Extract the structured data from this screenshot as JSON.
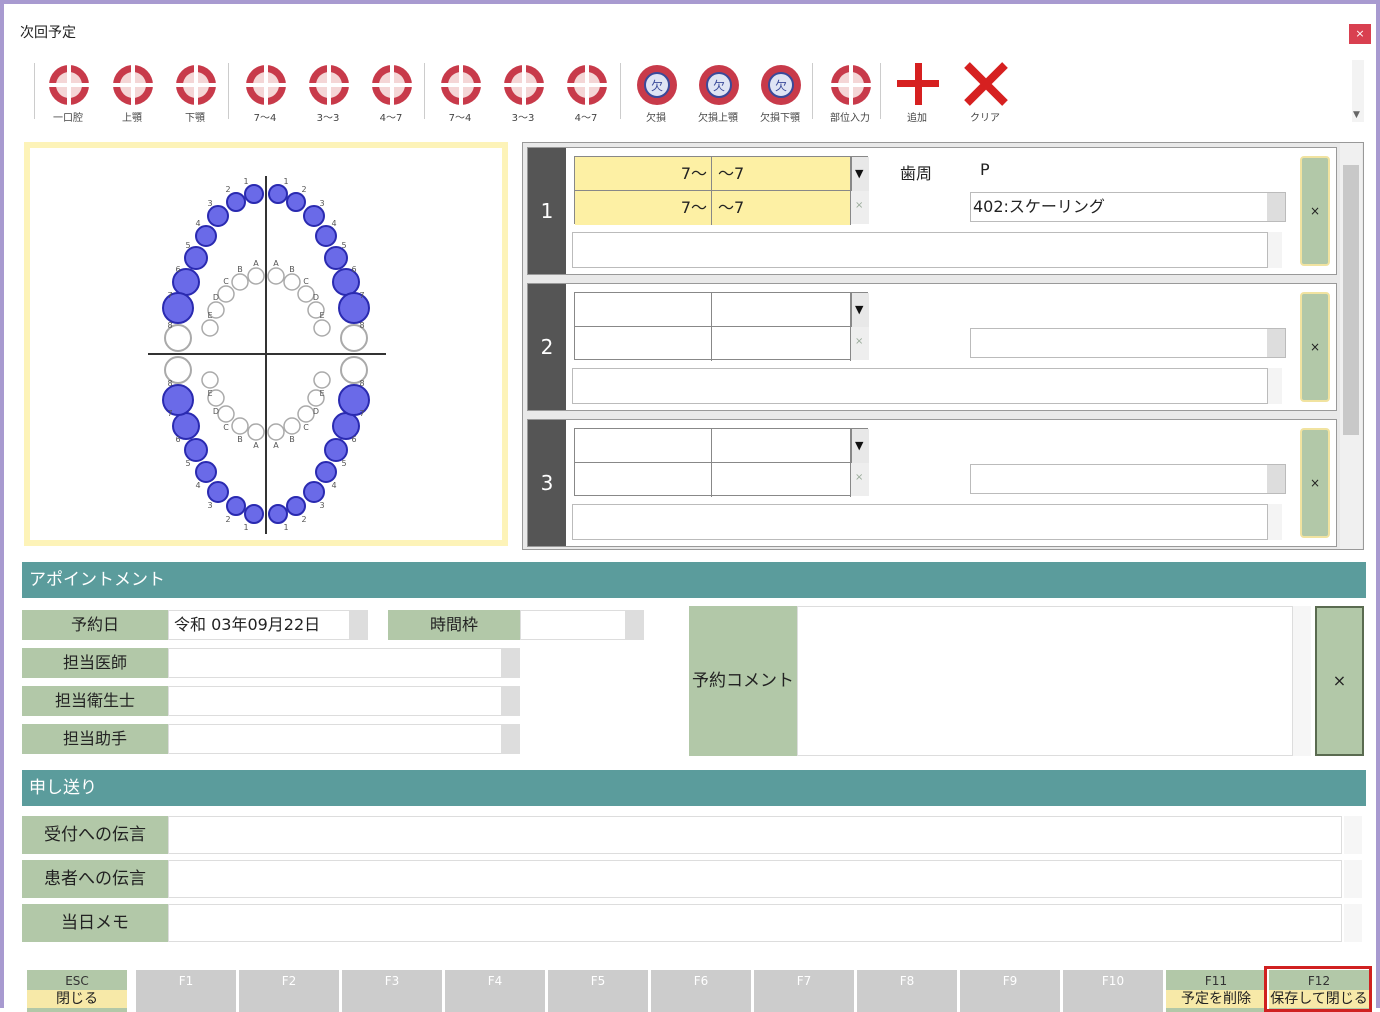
{
  "window": {
    "title": "次回予定",
    "close_label": "×"
  },
  "toolbar": {
    "buttons": [
      {
        "label": "一口腔",
        "icon": "full-mouth-icon"
      },
      {
        "label": "上顎",
        "icon": "upper-jaw-icon"
      },
      {
        "label": "下顎",
        "icon": "lower-jaw-icon"
      },
      {
        "label": "7～4",
        "icon": "upper-7-4-icon"
      },
      {
        "label": "3～3",
        "icon": "upper-3-3-icon"
      },
      {
        "label": "4～7",
        "icon": "upper-4-7-icon"
      },
      {
        "label": "7～4",
        "icon": "lower-7-4-icon"
      },
      {
        "label": "3～3",
        "icon": "lower-3-3-icon"
      },
      {
        "label": "4～7",
        "icon": "lower-4-7-icon"
      },
      {
        "label": "欠損",
        "icon": "missing-icon"
      },
      {
        "label": "欠損上顎",
        "icon": "missing-upper-icon"
      },
      {
        "label": "欠損下顎",
        "icon": "missing-lower-icon"
      },
      {
        "label": "部位入力",
        "icon": "site-input-icon"
      },
      {
        "label": "追加",
        "icon": "add-icon"
      },
      {
        "label": "クリア",
        "icon": "clear-icon"
      }
    ]
  },
  "tooth_chart": {
    "upper_right": [
      "1",
      "2",
      "3",
      "4",
      "5",
      "6",
      "7",
      "8"
    ],
    "primary": [
      "A",
      "B",
      "C",
      "D",
      "E"
    ]
  },
  "prescriptions": [
    {
      "num": "1",
      "range_top_left": "7～",
      "range_top_right": "～7",
      "range_bottom_left": "7～",
      "range_bottom_right": "～7",
      "category": "歯周",
      "code": "P",
      "treatment": "402:スケーリング",
      "delete_label": "×",
      "drop_glyph": "▼",
      "clear_glyph": "×"
    },
    {
      "num": "2",
      "range_top_left": "",
      "range_top_right": "",
      "range_bottom_left": "",
      "range_bottom_right": "",
      "category": "",
      "code": "",
      "treatment": "",
      "delete_label": "×",
      "drop_glyph": "▼",
      "clear_glyph": "×"
    },
    {
      "num": "3",
      "range_top_left": "",
      "range_top_right": "",
      "range_bottom_left": "",
      "range_bottom_right": "",
      "category": "",
      "code": "",
      "treatment": "",
      "delete_label": "×",
      "drop_glyph": "▼",
      "clear_glyph": "×"
    }
  ],
  "appointment": {
    "header": "アポイントメント",
    "date_label": "予約日",
    "date_value": "令和 03年09月22日",
    "timeslot_label": "時間枠",
    "timeslot_value": "",
    "doctor_label": "担当医師",
    "doctor_value": "",
    "hygienist_label": "担当衛生士",
    "hygienist_value": "",
    "assistant_label": "担当助手",
    "assistant_value": "",
    "comment_label": "予約コメント",
    "comment_value": "",
    "comment_delete": "×"
  },
  "handover": {
    "header": "申し送り",
    "reception_label": "受付への伝言",
    "patient_label": "患者への伝言",
    "memo_label": "当日メモ"
  },
  "footer": {
    "keys": [
      {
        "key": "ESC",
        "desc": "閉じる",
        "active": true
      },
      {
        "key": "F1",
        "desc": "",
        "active": false
      },
      {
        "key": "F2",
        "desc": "",
        "active": false
      },
      {
        "key": "F3",
        "desc": "",
        "active": false
      },
      {
        "key": "F4",
        "desc": "",
        "active": false
      },
      {
        "key": "F5",
        "desc": "",
        "active": false
      },
      {
        "key": "F6",
        "desc": "",
        "active": false
      },
      {
        "key": "F7",
        "desc": "",
        "active": false
      },
      {
        "key": "F8",
        "desc": "",
        "active": false
      },
      {
        "key": "F9",
        "desc": "",
        "active": false
      },
      {
        "key": "F10",
        "desc": "",
        "active": false
      },
      {
        "key": "F11",
        "desc": "予定を削除",
        "active": true
      },
      {
        "key": "F12",
        "desc": "保存して閉じる",
        "active": true
      }
    ]
  },
  "colors": {
    "accent": "#5b9c9c",
    "label_bg": "#b2c8a8",
    "highlight": "#fdf0a4",
    "selected_tooth": "#4a4ad8"
  }
}
